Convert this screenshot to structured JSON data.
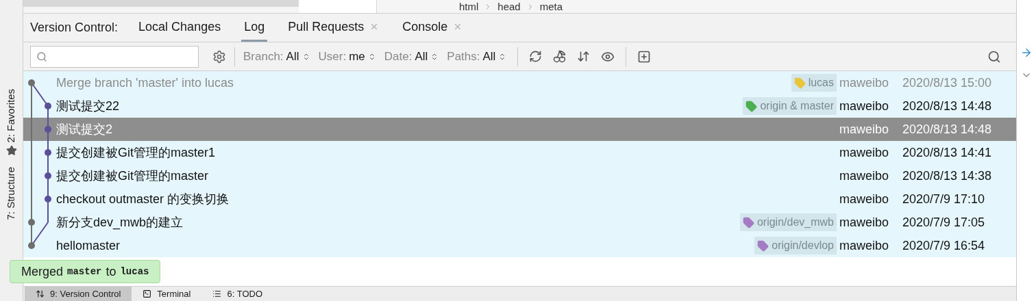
{
  "breadcrumbs": [
    "html",
    "head",
    "meta"
  ],
  "tool_window": {
    "label": "Version Control:",
    "tabs": [
      {
        "label": "Local Changes",
        "selected": false,
        "closable": false
      },
      {
        "label": "Log",
        "selected": true,
        "closable": false
      },
      {
        "label": "Pull Requests",
        "selected": false,
        "closable": true
      },
      {
        "label": "Console",
        "selected": false,
        "closable": true
      }
    ]
  },
  "filters": [
    {
      "label": "Branch:",
      "value": "All"
    },
    {
      "label": "User:",
      "value": "me"
    },
    {
      "label": "Date:",
      "value": "All"
    },
    {
      "label": "Paths:",
      "value": "All"
    }
  ],
  "commits": [
    {
      "message": "Merge branch 'master' into lucas",
      "author": "maweibo",
      "date": "2020/8/13 15:00",
      "selected": false,
      "dimmed": true,
      "color": "#6e6e6e",
      "tags": [
        {
          "label": "lucas",
          "color": "#e8c53a"
        }
      ]
    },
    {
      "message": "测试提交22",
      "author": "maweibo",
      "date": "2020/8/13 14:48",
      "selected": false,
      "dimmed": false,
      "color": "#5b4f9a",
      "tags": [
        {
          "label": "origin & master",
          "color": "#4caf50"
        }
      ]
    },
    {
      "message": "测试提交2",
      "author": "maweibo",
      "date": "2020/8/13 14:48",
      "selected": true,
      "dimmed": false,
      "color": "#5b4f9a"
    },
    {
      "message": "提交创建被Git管理的master1",
      "author": "maweibo",
      "date": "2020/8/13 14:41",
      "selected": false,
      "dimmed": false,
      "color": "#5b4f9a"
    },
    {
      "message": "提交创建被Git管理的master",
      "author": "maweibo",
      "date": "2020/8/13 14:38",
      "selected": false,
      "dimmed": false,
      "color": "#5b4f9a"
    },
    {
      "message": "checkout outmaster 的变换切换",
      "author": "maweibo",
      "date": "2020/7/9 17:10",
      "selected": false,
      "dimmed": false,
      "color": "#5b4f9a"
    },
    {
      "message": "新分支dev_mwb的建立",
      "author": "maweibo",
      "date": "2020/7/9 17:05",
      "selected": false,
      "dimmed": false,
      "color": "#6e6e6e",
      "tags": [
        {
          "label": "origin/dev_mwb",
          "color": "#a57bc4"
        }
      ]
    },
    {
      "message": "hellomaster",
      "author": "maweibo",
      "date": "2020/7/9 16:54",
      "selected": false,
      "dimmed": false,
      "color": "#6e6e6e",
      "tags": [
        {
          "label": "origin/devlop",
          "color": "#a57bc4"
        }
      ]
    }
  ],
  "side_tabs": [
    {
      "label": "2: Favorites",
      "kind": "favorites"
    },
    {
      "label": "7: Structure",
      "kind": "structure"
    }
  ],
  "notification": {
    "parts": [
      {
        "text": "Merged",
        "kind": "plain"
      },
      {
        "text": "master",
        "kind": "code"
      },
      {
        "text": "to",
        "kind": "plain"
      },
      {
        "text": "lucas",
        "kind": "code"
      }
    ]
  },
  "bottom_tabs": [
    {
      "label": "9: Version Control",
      "kind": "vcs",
      "selected": true
    },
    {
      "label": "Terminal",
      "kind": "terminal",
      "selected": false
    },
    {
      "label": "6: TODO",
      "kind": "todo",
      "selected": false
    }
  ]
}
